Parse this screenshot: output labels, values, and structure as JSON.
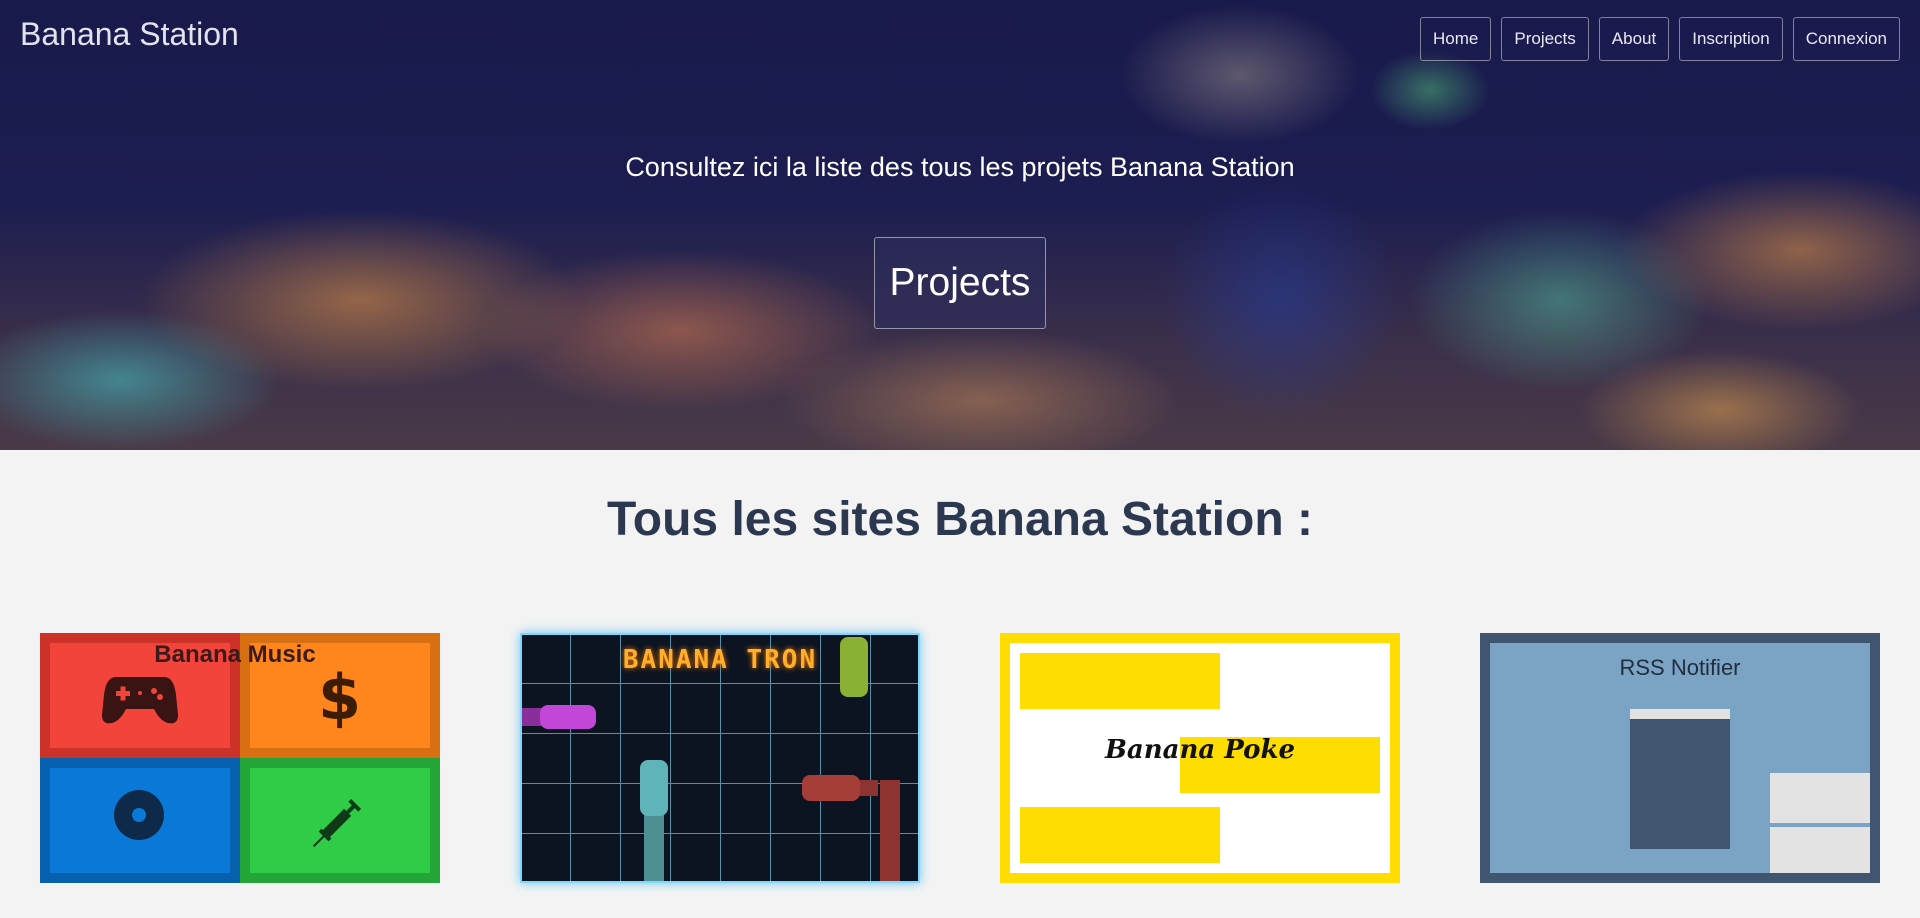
{
  "header": {
    "brand": "Banana Station",
    "nav": [
      "Home",
      "Projects",
      "About",
      "Inscription",
      "Connexion"
    ]
  },
  "hero": {
    "text": "Consultez ici la liste des tous les projets Banana Station",
    "button": "Projects"
  },
  "main": {
    "title": "Tous les sites Banana Station :",
    "cards": [
      {
        "title": "Banana Music"
      },
      {
        "title": "BANANA TRON"
      },
      {
        "title": "Banana Poke"
      },
      {
        "title": "RSS Notifier"
      }
    ]
  },
  "colors": {
    "hero_dark": "#191a4c",
    "music_red": "#f2443a",
    "music_orange": "#ff861c",
    "music_blue": "#0a78d6",
    "music_green": "#2fcc47",
    "poke_yellow": "#ffdd00",
    "rss_border": "#3f5570",
    "rss_bg": "#7ba3c4"
  }
}
